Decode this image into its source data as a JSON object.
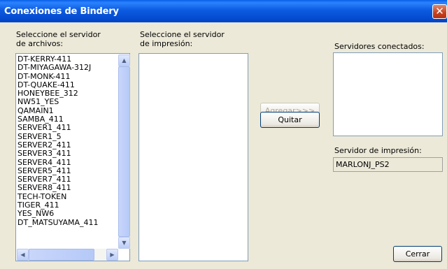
{
  "window": {
    "title": "Conexiones de Bindery",
    "close_symbol": "✕"
  },
  "file_servers": {
    "label": "Seleccione el servidor\nde archivos:",
    "items": [
      "DT-KERRY-411",
      "DT-MIYAGAWA-312J",
      "DT-MONK-411",
      "DT-QUAKE-411",
      "HONEYBEE_312",
      "NW51_YES",
      "QAMAIN1",
      "SAMBA_411",
      "SERVER1_411",
      "SERVER1_5",
      "SERVER2_411",
      "SERVER3_411",
      "SERVER4_411",
      "SERVER5_411",
      "SERVER7_411",
      "SERVER8_411",
      "TECH-TOKEN",
      "TIGER_411",
      "YES_NW6",
      "DT_MATSUYAMA_411"
    ]
  },
  "print_servers": {
    "label": "Seleccione el servidor\nde impresión:"
  },
  "buttons": {
    "add": "Agregar>>>",
    "remove": "Quitar",
    "close": "Cerrar"
  },
  "connected": {
    "label": "Servidores conectados:"
  },
  "print_server": {
    "label": "Servidor de impresión:",
    "value": "MARLONJ_PS2"
  }
}
